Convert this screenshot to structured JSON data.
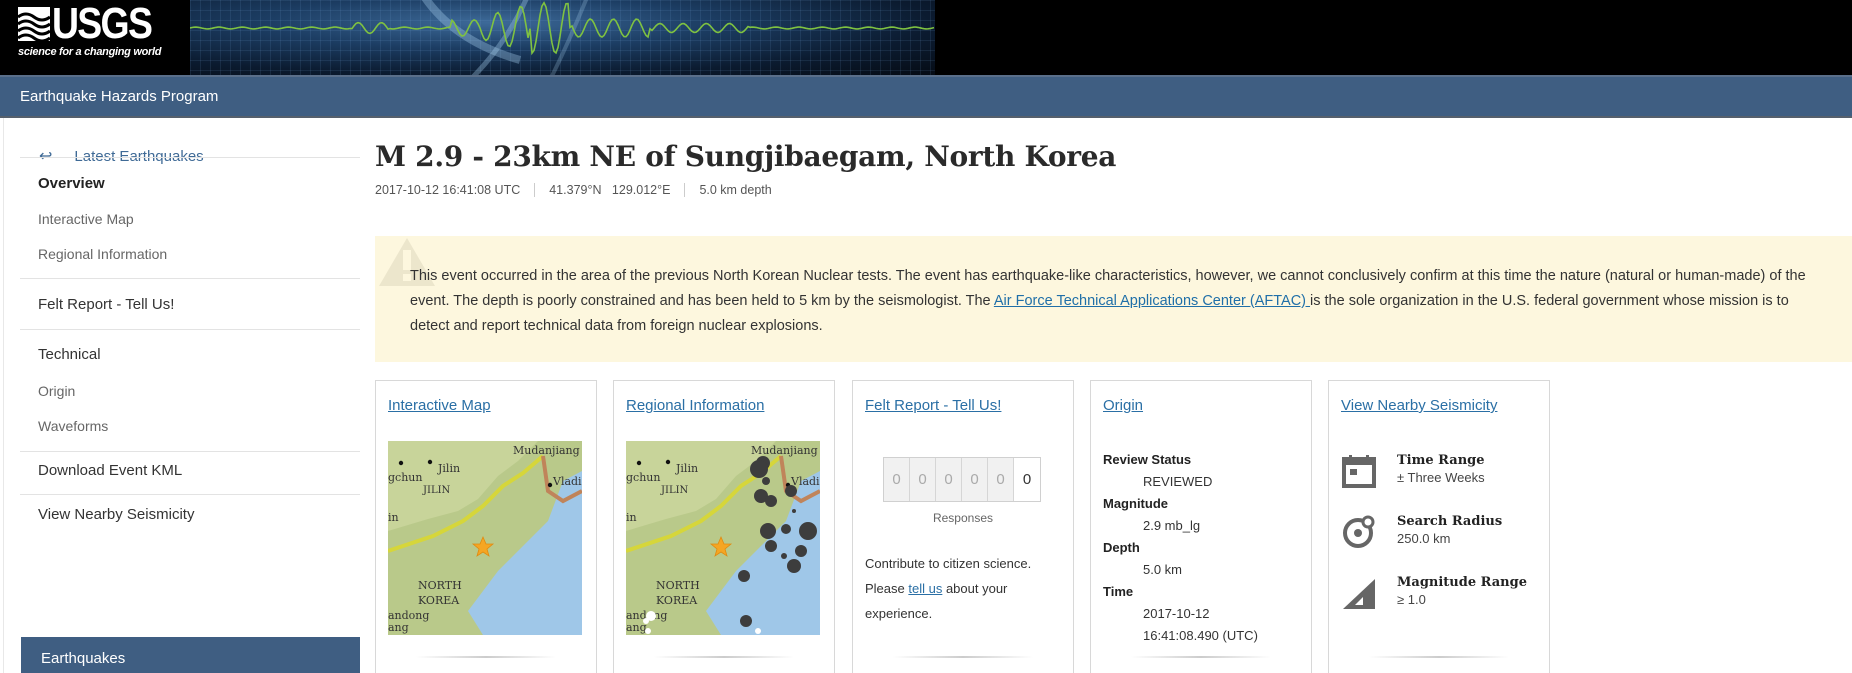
{
  "header": {
    "logo_text": "USGS",
    "logo_tagline": "science for a changing world",
    "program_title": "Earthquake Hazards Program"
  },
  "sidebar": {
    "back_link": "Latest Earthquakes",
    "back_icon": "arrow-left-icon",
    "items": [
      {
        "label": "Overview",
        "style": "bold"
      },
      {
        "label": "Interactive Map",
        "style": "sub"
      },
      {
        "label": "Regional Information",
        "style": "sub"
      },
      {
        "label": "Felt Report - Tell Us!",
        "style": "main"
      },
      {
        "label": "Technical",
        "style": "main"
      },
      {
        "label": "Origin",
        "style": "sub"
      },
      {
        "label": "Waveforms",
        "style": "sub"
      },
      {
        "label": "Download Event KML",
        "style": "main"
      },
      {
        "label": "View Nearby Seismicity",
        "style": "main"
      }
    ],
    "section_header": "Earthquakes"
  },
  "event": {
    "title": "M 2.9 - 23km NE of Sungjibaegam, North Korea",
    "time": "2017-10-12 16:41:08 UTC",
    "location": "41.379°N   129.012°E",
    "depth": "5.0 km depth"
  },
  "alert": {
    "icon": "warning-icon",
    "text_before_link": "This event occurred in the area of the previous North Korean Nuclear tests. The event has earthquake-like characteristics, however, we cannot conclusively confirm at this time the nature (natural or human-made) of the event. The depth is poorly constrained and has been held to 5 km by the seismologist. The ",
    "link_text": "Air Force Technical Applications Center (AFTAC) ",
    "text_after_link": "is the sole organization in the U.S. federal government whose mission is to detect and report technical data from foreign nuclear explosions."
  },
  "cards": {
    "interactive_map": {
      "title": "Interactive Map",
      "map_labels": [
        "Mudanjiang",
        "Jilin",
        "gchun",
        "JILIN",
        "Vladi",
        "in",
        "NORTH",
        "KOREA",
        "andong",
        "ang"
      ]
    },
    "regional_info": {
      "title": "Regional Information",
      "map_labels": [
        "Mudanjiang",
        "Jilin",
        "gchun",
        "JILIN",
        "Vladi",
        "in",
        "NORTH",
        "KOREA",
        "andong",
        "ang"
      ]
    },
    "felt_report": {
      "title": "Felt Report - Tell Us!",
      "counter_digits": [
        "0",
        "0",
        "0",
        "0",
        "0",
        "0"
      ],
      "responses": 0,
      "counter_label": "Responses",
      "text_before_link": "Contribute to citizen science. Please ",
      "link_text": "tell us",
      "text_after_link": " about your experience."
    },
    "origin": {
      "title": "Origin",
      "fields": [
        {
          "label": "Review Status",
          "values": [
            "REVIEWED"
          ]
        },
        {
          "label": "Magnitude",
          "values": [
            "2.9 mb_lg"
          ]
        },
        {
          "label": "Depth",
          "values": [
            "5.0 km"
          ]
        },
        {
          "label": "Time",
          "values": [
            "2017-10-12",
            "16:41:08.490 (UTC)"
          ]
        }
      ]
    },
    "nearby": {
      "title": "View Nearby Seismicity",
      "rows": [
        {
          "icon": "calendar-icon",
          "label": "Time Range",
          "value": "± Three Weeks"
        },
        {
          "icon": "search-radius-icon",
          "label": "Search Radius",
          "value": "250.0 km"
        },
        {
          "icon": "magnitude-range-icon",
          "label": "Magnitude Range",
          "value": "≥ 1.0"
        }
      ]
    }
  },
  "colors": {
    "program_bar": "#3f5e82",
    "link": "#2a6fa5",
    "alert_bg": "#fdf7de",
    "seismogram": "#7fc241",
    "epicenter": "#f5a623"
  }
}
